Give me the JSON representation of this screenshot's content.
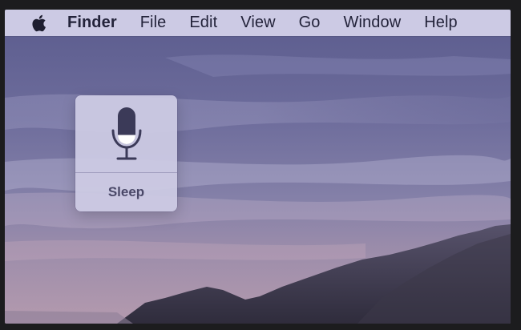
{
  "menubar": {
    "apple_icon": "apple-logo-icon",
    "items": [
      {
        "label": "Finder",
        "bold": true
      },
      {
        "label": "File"
      },
      {
        "label": "Edit"
      },
      {
        "label": "View"
      },
      {
        "label": "Go"
      },
      {
        "label": "Window"
      },
      {
        "label": "Help"
      }
    ]
  },
  "voice_control": {
    "icon": "microphone-icon",
    "status_label": "Sleep",
    "level": 0.25
  },
  "colors": {
    "menubar_bg": "#d6d4ec",
    "menu_text": "#23233a",
    "hud_bg": "#cecbe4",
    "mic_body": "#3b3a58",
    "mic_level_fill": "#ffffff",
    "status_text": "#4a4868"
  }
}
